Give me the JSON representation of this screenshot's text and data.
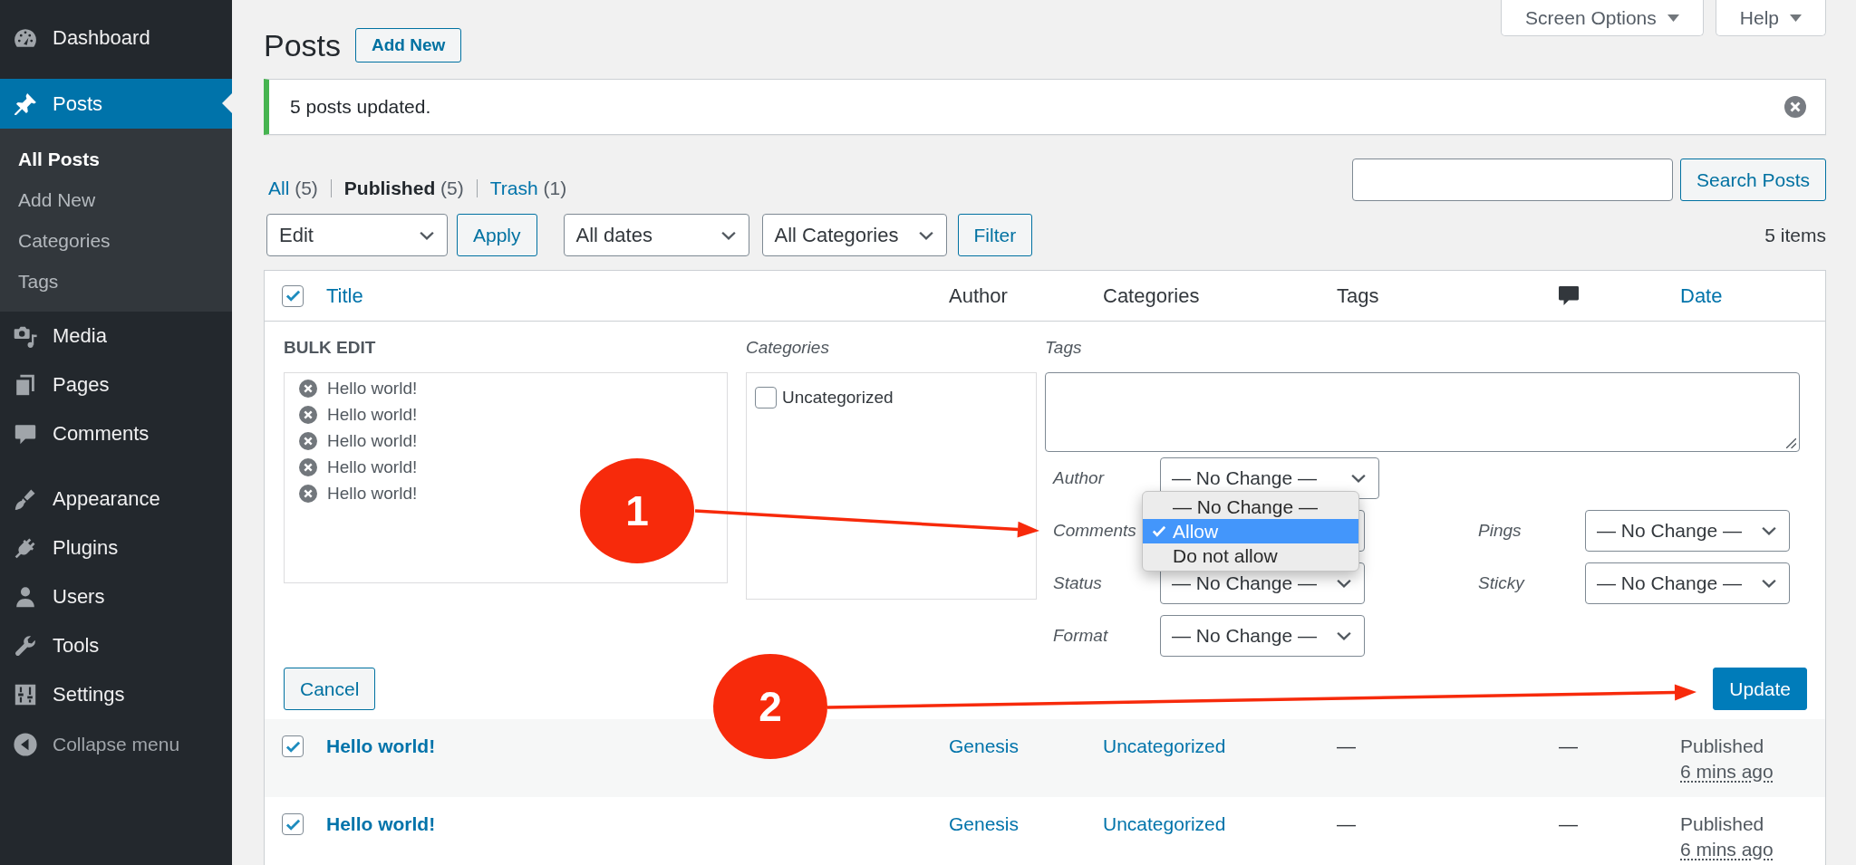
{
  "sidebar": {
    "groups": [
      {
        "items": [
          {
            "label": "Dashboard",
            "selected": false
          }
        ]
      },
      {
        "items": [
          {
            "label": "Posts",
            "selected": true,
            "children": [
              {
                "label": "All Posts",
                "selected": true
              },
              {
                "label": "Add New",
                "selected": false
              },
              {
                "label": "Categories",
                "selected": false
              },
              {
                "label": "Tags",
                "selected": false
              }
            ]
          },
          {
            "label": "Media",
            "selected": false
          },
          {
            "label": "Pages",
            "selected": false
          },
          {
            "label": "Comments",
            "selected": false
          }
        ]
      },
      {
        "items": [
          {
            "label": "Appearance",
            "selected": false
          },
          {
            "label": "Plugins",
            "selected": false
          },
          {
            "label": "Users",
            "selected": false
          },
          {
            "label": "Tools",
            "selected": false
          },
          {
            "label": "Settings",
            "selected": false
          }
        ]
      }
    ],
    "collapse": "Collapse menu"
  },
  "screen_tabs": [
    {
      "label": "Screen Options"
    },
    {
      "label": "Help"
    }
  ],
  "heading": {
    "title": "Posts",
    "add_new": "Add New"
  },
  "notice": {
    "message": "5 posts updated.",
    "dismissible": true
  },
  "views": [
    {
      "label": "All",
      "count": "(5)",
      "selected": false
    },
    {
      "label": "Published",
      "count": "(5)",
      "selected": true
    },
    {
      "label": "Trash",
      "count": "(1)",
      "selected": false
    }
  ],
  "search": {
    "button": "Search Posts"
  },
  "tablenav": {
    "bulk_action": "Edit",
    "apply": "Apply",
    "filters": [
      "All dates",
      "All Categories"
    ],
    "filter": "Filter",
    "count": "5 items"
  },
  "table": {
    "select_all": {
      "checked": true
    },
    "columns": [
      {
        "kind": "link",
        "label": "Title"
      },
      {
        "kind": "text",
        "label": "Author"
      },
      {
        "kind": "text",
        "label": "Categories"
      },
      {
        "kind": "text",
        "label": "Tags"
      },
      {
        "kind": "icon"
      },
      {
        "kind": "link",
        "label": "Date"
      }
    ],
    "bulk_edit": {
      "title": "BULK EDIT",
      "posts": [
        {
          "title": "Hello world!"
        },
        {
          "title": "Hello world!"
        },
        {
          "title": "Hello world!"
        },
        {
          "title": "Hello world!"
        },
        {
          "title": "Hello world!"
        }
      ],
      "categories": {
        "label": "Categories",
        "items": [
          {
            "label": "Uncategorized",
            "checked": false
          }
        ]
      },
      "tags": {
        "label": "Tags"
      },
      "fields": [
        {
          "label": "Author",
          "value": "— No Change —"
        },
        {
          "label": "Comments",
          "open": true,
          "options": [
            {
              "label": "— No Change —",
              "selected": false
            },
            {
              "label": "Allow",
              "selected": true
            },
            {
              "label": "Do not allow",
              "selected": false
            }
          ]
        },
        {
          "label": "Status",
          "value": "— No Change —"
        },
        {
          "label": "Format",
          "value": "— No Change —"
        }
      ],
      "side_fields": [
        {
          "label": "Pings",
          "value": "— No Change —"
        },
        {
          "label": "Sticky",
          "value": "— No Change —"
        }
      ],
      "cancel": "Cancel",
      "update": "Update"
    },
    "rows": [
      {
        "checked": true,
        "title": "Hello world!",
        "author": "Genesis",
        "categories": "Uncategorized",
        "tags": "—",
        "comments": "—",
        "status": "Published",
        "date": "6 mins ago"
      },
      {
        "checked": true,
        "title": "Hello world!",
        "author": "Genesis",
        "categories": "Uncategorized",
        "tags": "—",
        "comments": "—",
        "status": "Published",
        "date": "6 mins ago"
      }
    ]
  },
  "annotations": [
    {
      "label": "1"
    },
    {
      "label": "2"
    }
  ]
}
